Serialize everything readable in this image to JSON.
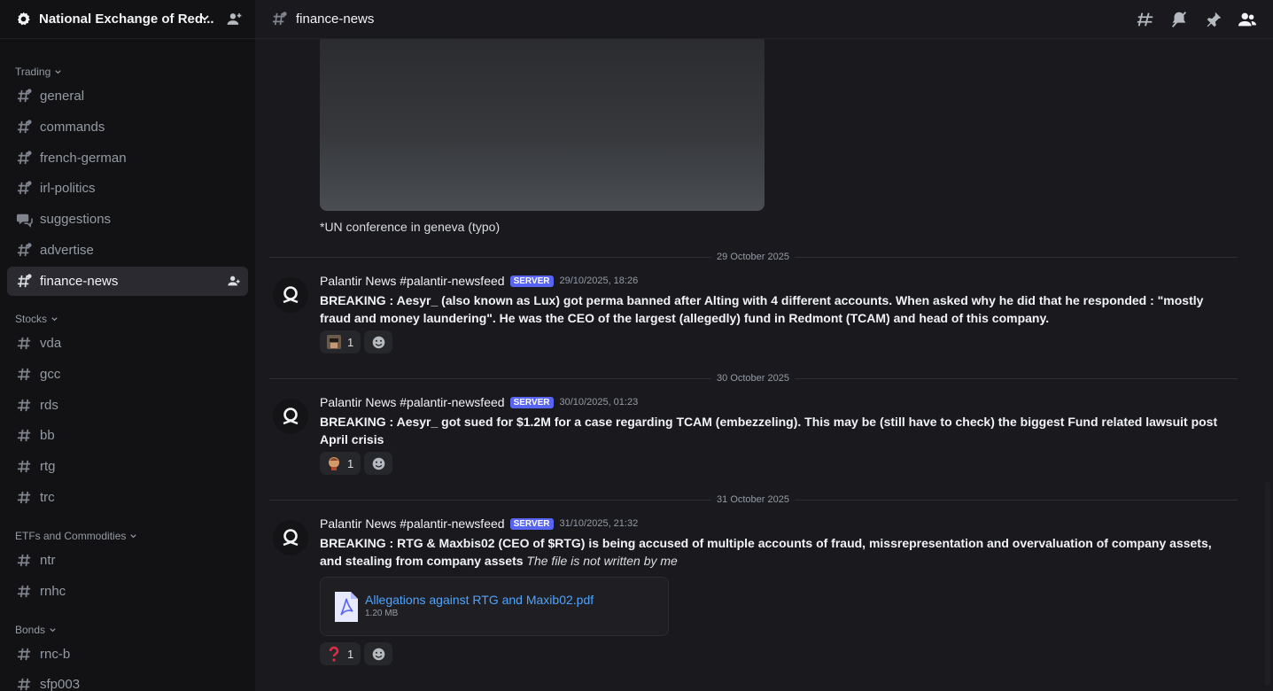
{
  "server": {
    "name": "National Exchange of Red..."
  },
  "topbar": {
    "channel": "finance-news"
  },
  "categories": [
    {
      "name": "Trading"
    },
    {
      "name": "Stocks"
    },
    {
      "name": "ETFs and Commodities"
    },
    {
      "name": "Bonds"
    }
  ],
  "channels": {
    "trading": [
      "general",
      "commands",
      "french-german",
      "irl-politics",
      "suggestions",
      "advertise",
      "finance-news"
    ],
    "stocks": [
      "vda",
      "gcc",
      "rds",
      "bb",
      "rtg",
      "trc"
    ],
    "etfs": [
      "ntr",
      "rnhc"
    ],
    "bonds": [
      "rnc-b",
      "sfp003"
    ]
  },
  "main": {
    "image_caption": "*UN conference in geneva (typo)",
    "dividers": [
      "29 October 2025",
      "30 October 2025",
      "31 October 2025"
    ],
    "messages": [
      {
        "author": "Palantir News #palantir-newsfeed",
        "badge": "SERVER",
        "time": "29/10/2025, 18:26",
        "body": "BREAKING : Aesyr_ (also known as Lux) got perma banned after Alting with 4 different accounts. When asked why he did that he responded : \"mostly fraud and money laundering\". He was the CEO of the largest (allegedly) fund in Redmont (TCAM) and head of this company.",
        "reaction_count": "1"
      },
      {
        "author": "Palantir News #palantir-newsfeed",
        "badge": "SERVER",
        "time": "30/10/2025, 01:23",
        "body": "BREAKING : Aesyr_ got sued for $1.2M for a case regarding TCAM (embezzeling). This may be (still have to check) the biggest Fund related lawsuit post April crisis",
        "reaction_count": "1"
      },
      {
        "author": "Palantir News #palantir-newsfeed",
        "badge": "SERVER",
        "time": "31/10/2025, 21:32",
        "body": "BREAKING : RTG & Maxbis02 (CEO of $RTG) is being accused of multiple accounts of fraud, missrepresentation and overvaluation of company assets, and stealing from company assets",
        "body_italic": "The file is not written by me",
        "reaction_count": "1",
        "attachment": {
          "name": "Allegations against RTG and Maxib02.pdf",
          "size": "1.20 MB"
        }
      }
    ]
  },
  "colors": {
    "accent": "#5865f2",
    "link": "#4ea3ff",
    "sidebar_bg": "#121214",
    "main_bg": "#1a1a1e"
  },
  "icons": [
    "gear-icon",
    "chevron-down-icon",
    "add-member-icon",
    "hash-icon",
    "thread-icon",
    "forum-icon",
    "mute-icon",
    "pin-icon",
    "members-icon",
    "smile-add-icon",
    "pdf-file-icon"
  ]
}
